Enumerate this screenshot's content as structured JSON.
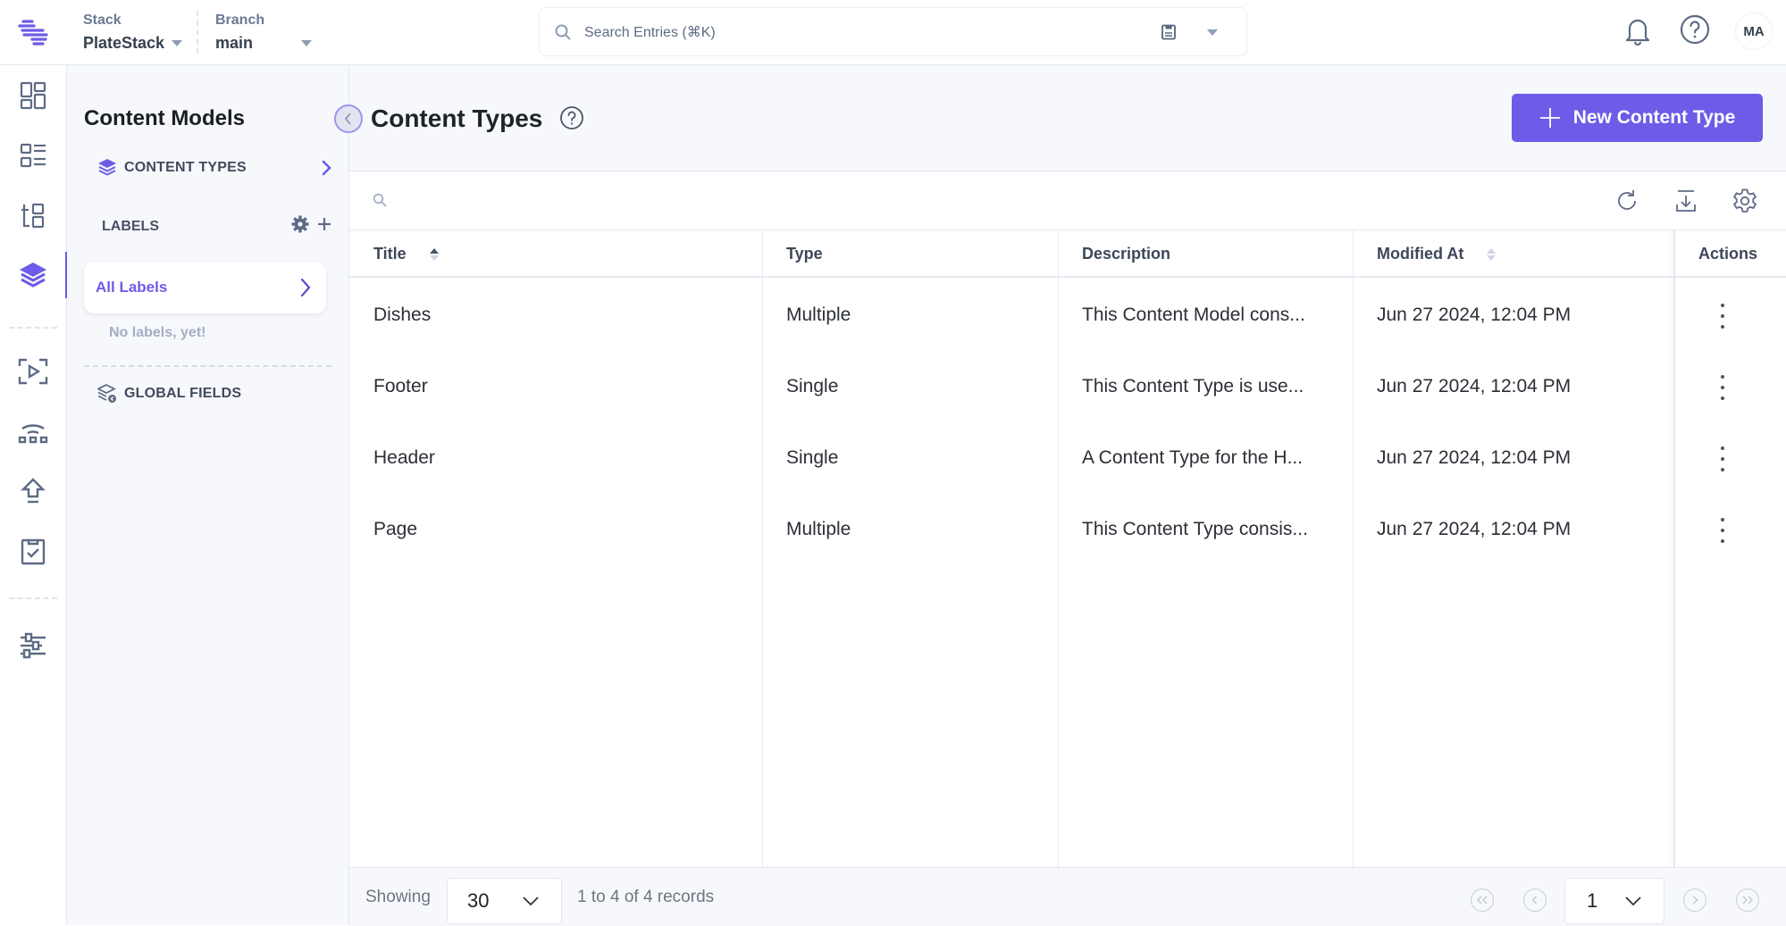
{
  "topbar": {
    "stack_label": "Stack",
    "stack_value": "PlateStack",
    "branch_label": "Branch",
    "branch_value": "main",
    "search_placeholder": "Search Entries (⌘K)",
    "avatar_initials": "MA"
  },
  "rail": {
    "items": [
      {
        "icon": "dashboard-icon",
        "active": false
      },
      {
        "icon": "entries-icon",
        "active": false
      },
      {
        "icon": "assets-icon",
        "active": false
      },
      {
        "icon": "content-models-icon",
        "active": true
      },
      {
        "icon": "publish-queue-icon",
        "active": false
      },
      {
        "icon": "releases-icon",
        "active": false
      },
      {
        "icon": "deploy-icon",
        "active": false
      },
      {
        "icon": "tasks-icon",
        "active": false
      },
      {
        "icon": "settings-sliders-icon",
        "active": false
      }
    ]
  },
  "sidebar": {
    "title": "Content Models",
    "content_types_label": "CONTENT TYPES",
    "labels_heading": "LABELS",
    "all_labels": "All Labels",
    "no_labels": "No labels, yet!",
    "global_fields_label": "GLOBAL FIELDS"
  },
  "main": {
    "title": "Content Types",
    "new_button": "New Content Type",
    "table": {
      "columns": [
        "Title",
        "Type",
        "Description",
        "Modified At",
        "Actions"
      ],
      "sort": {
        "column": "Title",
        "direction": "asc"
      },
      "rows": [
        {
          "title": "Dishes",
          "type": "Multiple",
          "description": "This Content Model cons...",
          "modified": "Jun 27 2024, 12:04 PM"
        },
        {
          "title": "Footer",
          "type": "Single",
          "description": "This Content Type is use...",
          "modified": "Jun 27 2024, 12:04 PM"
        },
        {
          "title": "Header",
          "type": "Single",
          "description": "A Content Type for the H...",
          "modified": "Jun 27 2024, 12:04 PM"
        },
        {
          "title": "Page",
          "type": "Multiple",
          "description": "This Content Type consis...",
          "modified": "Jun 27 2024, 12:04 PM"
        }
      ]
    },
    "footer": {
      "showing_label": "Showing",
      "page_size": "30",
      "records_text": "1 to 4 of 4 records",
      "current_page": "1"
    }
  },
  "colors": {
    "accent": "#6c5ce7",
    "text_dark": "#1f232a",
    "muted": "#6b7a94",
    "border": "#e3e8f0",
    "panel_bg": "#f7f8fc"
  }
}
